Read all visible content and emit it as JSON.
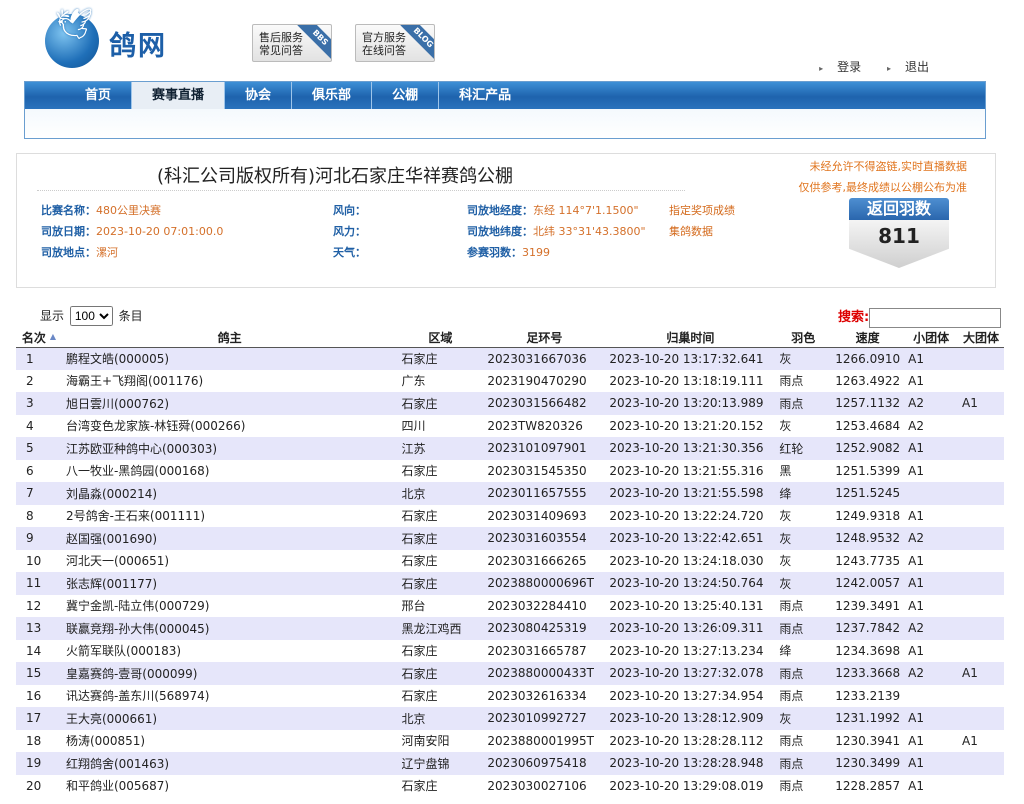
{
  "header": {
    "brand": "鸽网",
    "service1": {
      "line1": "售后服务",
      "line2": "常见问答",
      "tag": "BBS"
    },
    "service2": {
      "line1": "官方服务",
      "line2": "在线问答",
      "tag": "BLOG"
    },
    "login": "登录",
    "logout": "退出"
  },
  "nav": {
    "items": [
      "首页",
      "赛事直播",
      "协会",
      "俱乐部",
      "公棚",
      "科汇产品"
    ],
    "active": 1
  },
  "info": {
    "title": "(科汇公司版权所有)河北石家庄华祥赛鸽公棚",
    "race_name_label": "比赛名称：",
    "race_name": "480公里决赛",
    "release_date_label": "司放日期：",
    "release_date": "2023-10-20 07:01:00.0",
    "release_place_label": "司放地点：",
    "release_place": "漯河",
    "wind_dir_label": "风向：",
    "wind_force_label": "风力：",
    "weather_label": "天气：",
    "lon_label": "司放地经度：",
    "lon": "东经 114°7'1.1500\"",
    "lat_label": "司放地纬度：",
    "lat": "北纬 33°31'43.3800\"",
    "count_label": "参赛羽数：",
    "count": "3199",
    "link1": "指定奖项成绩",
    "link2": "集鸽数据",
    "warning1": "未经允许不得盗链,实时直播数据",
    "warning2": "仅供参考,最终成绩以公棚公布为准",
    "return_label": "返回羽数",
    "return_count": "811"
  },
  "controls": {
    "show_label": "显示",
    "show_value": "100",
    "entries_label": "条目",
    "search_label": "搜索:"
  },
  "table": {
    "columns": [
      "名次",
      "鸽主",
      "区域",
      "足环号",
      "归巢时间",
      "羽色",
      "速度",
      "小团体",
      "大团体"
    ],
    "rows": [
      [
        "1",
        "鹏程文皓(000005)",
        "石家庄",
        "2023031667036",
        "2023-10-20 13:17:32.641",
        "灰",
        "1266.0910",
        "A1",
        ""
      ],
      [
        "2",
        "海霸王+飞翔阁(001176)",
        "广东",
        "2023190470290",
        "2023-10-20 13:18:19.111",
        "雨点",
        "1263.4922",
        "A1",
        ""
      ],
      [
        "3",
        "旭日雲川(000762)",
        "石家庄",
        "2023031566482",
        "2023-10-20 13:20:13.989",
        "雨点",
        "1257.1132",
        "A2",
        "A1"
      ],
      [
        "4",
        "台湾变色龙家族-林钰舜(000266)",
        "四川",
        "2023TW820326",
        "2023-10-20 13:21:20.152",
        "灰",
        "1253.4684",
        "A2",
        ""
      ],
      [
        "5",
        "江苏欧亚种鸽中心(000303)",
        "江苏",
        "2023101097901",
        "2023-10-20 13:21:30.356",
        "红轮",
        "1252.9082",
        "A1",
        ""
      ],
      [
        "6",
        "八一牧业-黑鸽园(000168)",
        "石家庄",
        "2023031545350",
        "2023-10-20 13:21:55.316",
        "黑",
        "1251.5399",
        "A1",
        ""
      ],
      [
        "7",
        "刘晶淼(000214)",
        "北京",
        "2023011657555",
        "2023-10-20 13:21:55.598",
        "绛",
        "1251.5245",
        "",
        ""
      ],
      [
        "8",
        "2号鸽舍-王石来(001111)",
        "石家庄",
        "2023031409693",
        "2023-10-20 13:22:24.720",
        "灰",
        "1249.9318",
        "A1",
        ""
      ],
      [
        "9",
        "赵国强(001690)",
        "石家庄",
        "2023031603554",
        "2023-10-20 13:22:42.651",
        "灰",
        "1248.9532",
        "A2",
        ""
      ],
      [
        "10",
        "河北天一(000651)",
        "石家庄",
        "2023031666265",
        "2023-10-20 13:24:18.030",
        "灰",
        "1243.7735",
        "A1",
        ""
      ],
      [
        "11",
        "张志辉(001177)",
        "石家庄",
        "2023880000696T",
        "2023-10-20 13:24:50.764",
        "灰",
        "1242.0057",
        "A1",
        ""
      ],
      [
        "12",
        "冀宁金凯-陆立伟(000729)",
        "邢台",
        "2023032284410",
        "2023-10-20 13:25:40.131",
        "雨点",
        "1239.3491",
        "A1",
        ""
      ],
      [
        "13",
        "联赢竞翔-孙大伟(000045)",
        "黑龙江鸡西",
        "2023080425319",
        "2023-10-20 13:26:09.311",
        "雨点",
        "1237.7842",
        "A2",
        ""
      ],
      [
        "14",
        "火箭军联队(000183)",
        "石家庄",
        "2023031665787",
        "2023-10-20 13:27:13.234",
        "绛",
        "1234.3698",
        "A1",
        ""
      ],
      [
        "15",
        "皇嘉赛鸽-壹哥(000099)",
        "石家庄",
        "2023880000433T",
        "2023-10-20 13:27:32.078",
        "雨点",
        "1233.3668",
        "A2",
        "A1"
      ],
      [
        "16",
        "讯达赛鸽-盖东川(568974)",
        "石家庄",
        "2023032616334",
        "2023-10-20 13:27:34.954",
        "雨点",
        "1233.2139",
        "",
        ""
      ],
      [
        "17",
        "王大亮(000661)",
        "北京",
        "2023010992727",
        "2023-10-20 13:28:12.909",
        "灰",
        "1231.1992",
        "A1",
        ""
      ],
      [
        "18",
        "杨涛(000851)",
        "河南安阳",
        "2023880001995T",
        "2023-10-20 13:28:28.112",
        "雨点",
        "1230.3941",
        "A1",
        "A1"
      ],
      [
        "19",
        "红翔鸽舍(001463)",
        "辽宁盘锦",
        "2023060975418",
        "2023-10-20 13:28:28.948",
        "雨点",
        "1230.3499",
        "A1",
        ""
      ],
      [
        "20",
        "和平鸽业(005687)",
        "石家庄",
        "2023030027106",
        "2023-10-20 13:29:08.019",
        "雨点",
        "1228.2857",
        "A1",
        ""
      ]
    ]
  }
}
